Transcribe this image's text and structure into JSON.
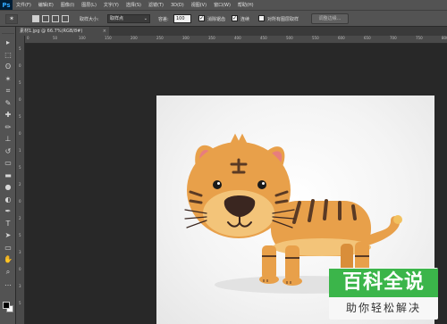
{
  "app": {
    "logo": "Ps"
  },
  "menu": [
    "文件(F)",
    "编辑(E)",
    "图像(I)",
    "图层(L)",
    "文字(Y)",
    "选择(S)",
    "滤镜(T)",
    "3D(D)",
    "视图(V)",
    "窗口(W)",
    "帮助(H)"
  ],
  "options": {
    "tool_icon": "lasso-arrow-icon",
    "feather_label": "取样大小:",
    "sample_size_value": "取样点",
    "tolerance_label": "容差:",
    "tolerance_value": "100",
    "antialias_label": "消除锯齿",
    "antialias_checked": true,
    "contiguous_label": "连续",
    "contiguous_checked": true,
    "all_layers_label": "对所有图层取样",
    "all_layers_checked": false,
    "refine_edge_label": "调整边缘..."
  },
  "document": {
    "tab_title": "素材1.jpg @ 66.7%(RGB/8#)",
    "close_glyph": "×"
  },
  "ruler": {
    "top_ticks": [
      "0",
      "50",
      "100",
      "150",
      "200",
      "250",
      "300",
      "350",
      "400",
      "450",
      "500",
      "550",
      "600",
      "650",
      "700",
      "750",
      "800"
    ],
    "left_ticks": [
      "5",
      "0",
      "5",
      "0",
      "5",
      "0",
      "1",
      "5",
      "2",
      "0",
      "2",
      "5",
      "3",
      "0",
      "3",
      "5"
    ]
  },
  "toolbox": {
    "tools": [
      "move-icon",
      "marquee-icon",
      "lasso-icon",
      "magic-wand-icon",
      "crop-icon",
      "eyedropper-icon",
      "healing-brush-icon",
      "brush-icon",
      "clone-stamp-icon",
      "history-brush-icon",
      "eraser-icon",
      "gradient-icon",
      "blur-icon",
      "dodge-icon",
      "pen-icon",
      "type-icon",
      "path-select-icon",
      "shape-icon",
      "hand-icon",
      "zoom-icon",
      "more-tools-icon"
    ],
    "tool_glyphs": [
      "▸",
      "⬚",
      "ʘ",
      "✶",
      "⌗",
      "✎",
      "✚",
      "✏",
      "⊥",
      "↺",
      "▭",
      "▬",
      "●",
      "◐",
      "✒",
      "T",
      "➤",
      "▭",
      "✋",
      "⌕",
      "…"
    ],
    "fg_color": "#000000",
    "bg_color": "#ffffff"
  },
  "watermark": {
    "title": "百科全说",
    "subtitle": "助你轻松解决",
    "color": "#3bb54a"
  },
  "colors": {
    "ui_dark": "#282828",
    "ui_panel": "#535353",
    "tiger_orange": "#e8a04a",
    "tiger_stripe": "#5a3a24"
  }
}
